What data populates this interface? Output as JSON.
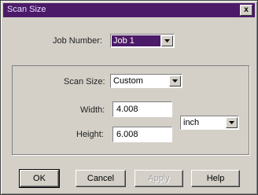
{
  "window": {
    "title": "Scan Size",
    "close_glyph": "x"
  },
  "job": {
    "label": "Job Number:",
    "value": "Job 1"
  },
  "scan": {
    "size_label": "Scan Size:",
    "size_value": "Custom",
    "width_label": "Width:",
    "width_value": "4.008",
    "height_label": "Height:",
    "height_value": "6.008",
    "unit_value": "inch"
  },
  "buttons": {
    "ok": "OK",
    "cancel": "Cancel",
    "apply": "Apply",
    "help": "Help"
  },
  "colors": {
    "titlebar": "#4b1a68",
    "face": "#d4d0c8",
    "selection": "#4b1a68"
  }
}
